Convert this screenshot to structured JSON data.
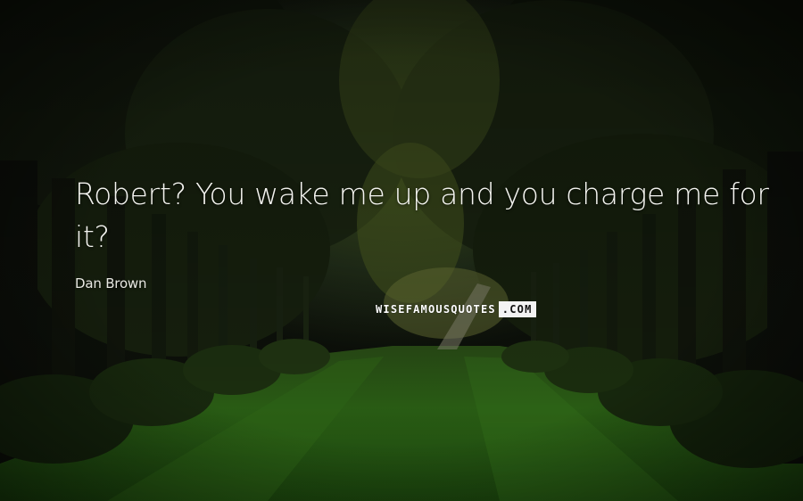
{
  "quote": {
    "text": "Robert? You wake me up and you charge me for it?",
    "author": "Dan Brown"
  },
  "logo": {
    "main": "WISEFAMOUSQUOTES",
    "tld": ".COM"
  },
  "colors": {
    "text": "#f4f4f0",
    "background_dark": "#0c0f08",
    "grass": "#2e6a16",
    "foliage": "#1d2a12"
  }
}
